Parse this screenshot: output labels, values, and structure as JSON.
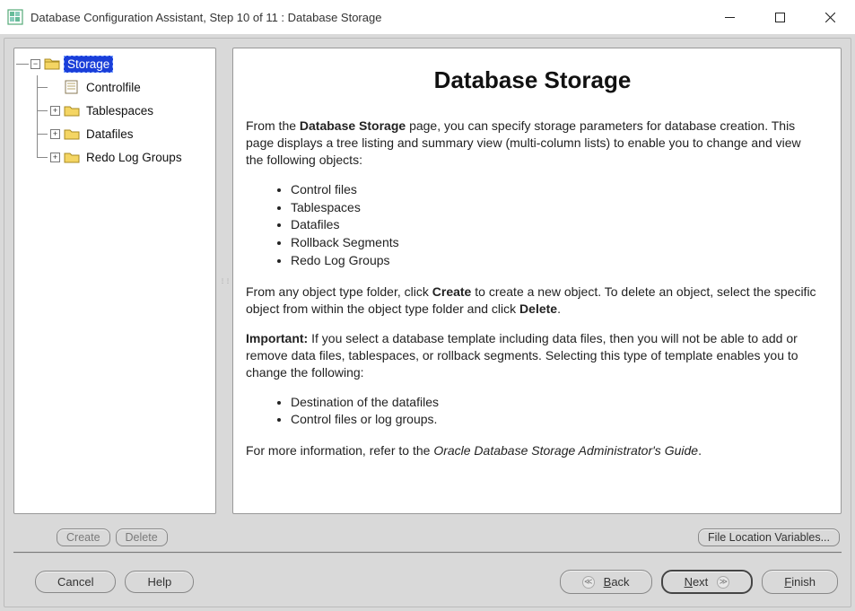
{
  "window": {
    "title": "Database Configuration Assistant, Step 10 of 11 : Database Storage"
  },
  "tree": {
    "root": {
      "label": "Storage"
    },
    "children": [
      {
        "label": "Controlfile",
        "type": "file"
      },
      {
        "label": "Tablespaces",
        "type": "folder"
      },
      {
        "label": "Datafiles",
        "type": "folder"
      },
      {
        "label": "Redo Log Groups",
        "type": "folder"
      }
    ]
  },
  "content": {
    "heading": "Database Storage",
    "p1_pre": "From the ",
    "p1_bold": "Database Storage",
    "p1_post": " page, you can specify storage parameters for database creation. This page displays a tree listing and summary view (multi-column lists) to enable you to change and view the following objects:",
    "list1": [
      "Control files",
      "Tablespaces",
      "Datafiles",
      "Rollback Segments",
      "Redo Log Groups"
    ],
    "p2_pre": "From any object type folder, click ",
    "p2_b1": "Create",
    "p2_mid": " to create a new object. To delete an object, select the specific object from within the object type folder and click ",
    "p2_b2": "Delete",
    "p2_post": ".",
    "p3_b": "Important:",
    "p3_post": " If you select a database template including data files, then you will not be able to add or remove data files, tablespaces, or rollback segments. Selecting this type of template enables you to change the following:",
    "list2": [
      "Destination of the datafiles",
      "Control files or log groups."
    ],
    "p4_pre": "For more information, refer to the ",
    "p4_it": "Oracle Database Storage Administrator's Guide",
    "p4_post": "."
  },
  "buttons": {
    "create": "Create",
    "delete": "Delete",
    "fileloc": "File Location Variables...",
    "cancel": "Cancel",
    "help": "Help",
    "back_u": "B",
    "back_rest": "ack",
    "next_u": "N",
    "next_rest": "ext",
    "finish_u": "F",
    "finish_rest": "inish"
  }
}
